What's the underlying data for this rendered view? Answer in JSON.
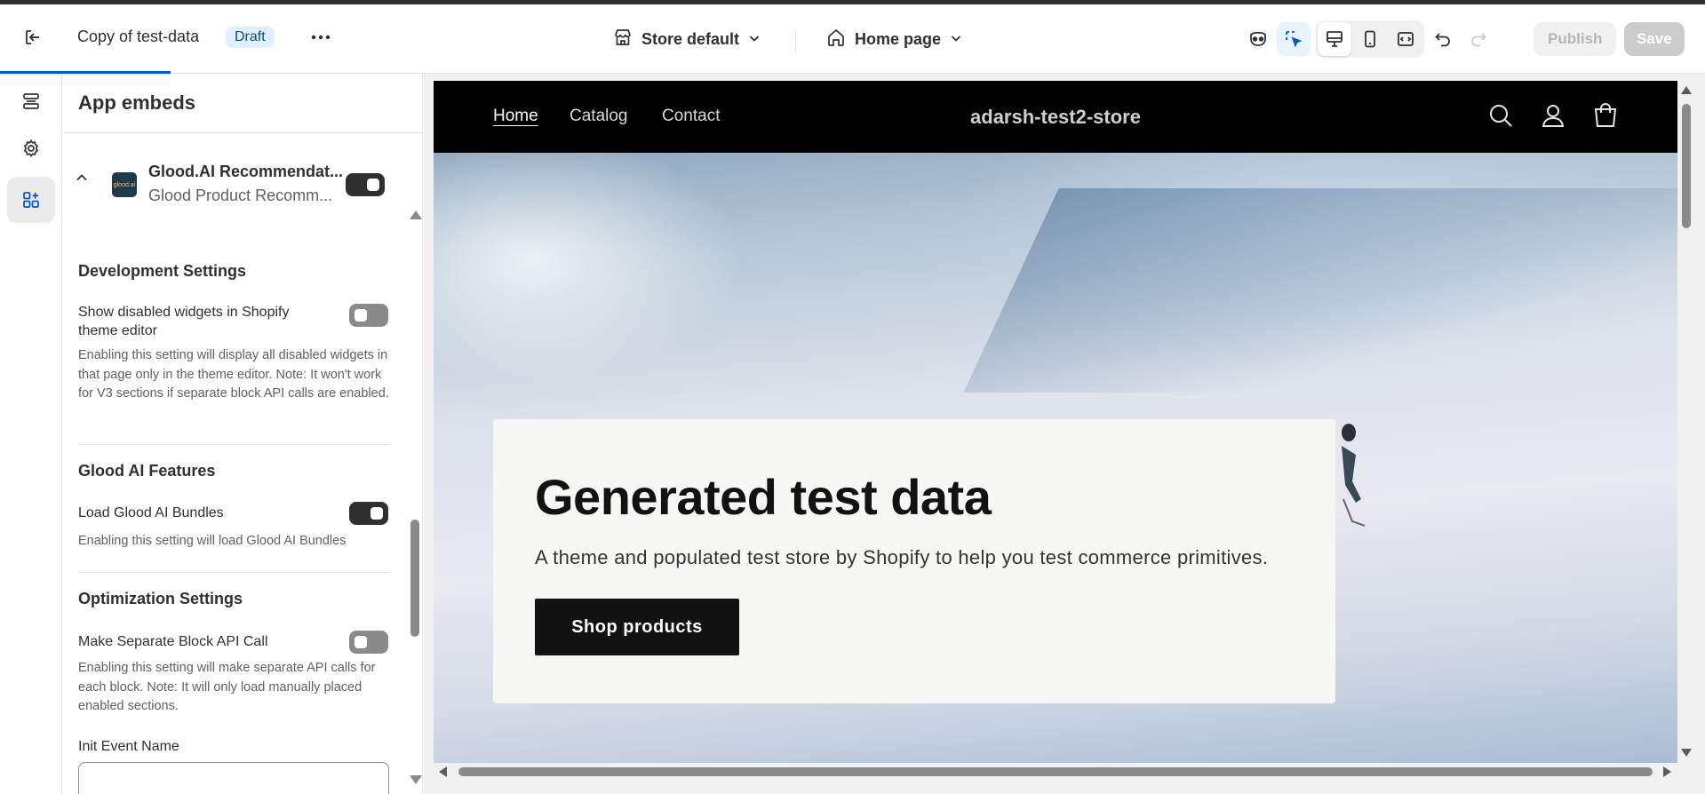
{
  "topbar": {
    "doc_title": "Copy of test-data",
    "status_badge": "Draft",
    "store_selector": "Store default",
    "page_selector": "Home page",
    "publish_label": "Publish",
    "save_label": "Save"
  },
  "sidebar": {
    "title": "App embeds",
    "app": {
      "logo_text": "glood.ai",
      "name": "Glood.AI Recommendat...",
      "subtitle": "Glood Product Recomm...",
      "enabled": true
    },
    "sections": [
      {
        "title": "Development Settings",
        "settings": [
          {
            "label": "Show disabled widgets in Shopify theme editor",
            "help": "Enabling this setting will display all disabled widgets in that page only in the theme editor. Note: It won't work for V3 sections if separate block API calls are enabled.",
            "enabled": false
          }
        ]
      },
      {
        "title": "Glood AI Features",
        "settings": [
          {
            "label": "Load Glood AI Bundles",
            "help": "Enabling this setting will load Glood AI Bundles",
            "enabled": true
          }
        ]
      },
      {
        "title": "Optimization Settings",
        "settings": [
          {
            "label": "Make Separate Block API Call",
            "help": "Enabling this setting will make separate API calls for each block. Note: It will only load manually placed enabled sections.",
            "enabled": false
          }
        ]
      }
    ],
    "init_event_label": "Init Event Name",
    "init_event_value": ""
  },
  "preview": {
    "nav": [
      "Home",
      "Catalog",
      "Contact"
    ],
    "store_name": "adarsh-test2-store",
    "hero_title": "Generated test data",
    "hero_subtitle": "A theme and populated test store by Shopify to help you test commerce primitives.",
    "hero_button": "Shop products"
  },
  "colors": {
    "accent": "#005bd3",
    "toggle_on": "#303030",
    "toggle_off": "#8a8a8a",
    "badge_bg": "#e0f0ff"
  }
}
